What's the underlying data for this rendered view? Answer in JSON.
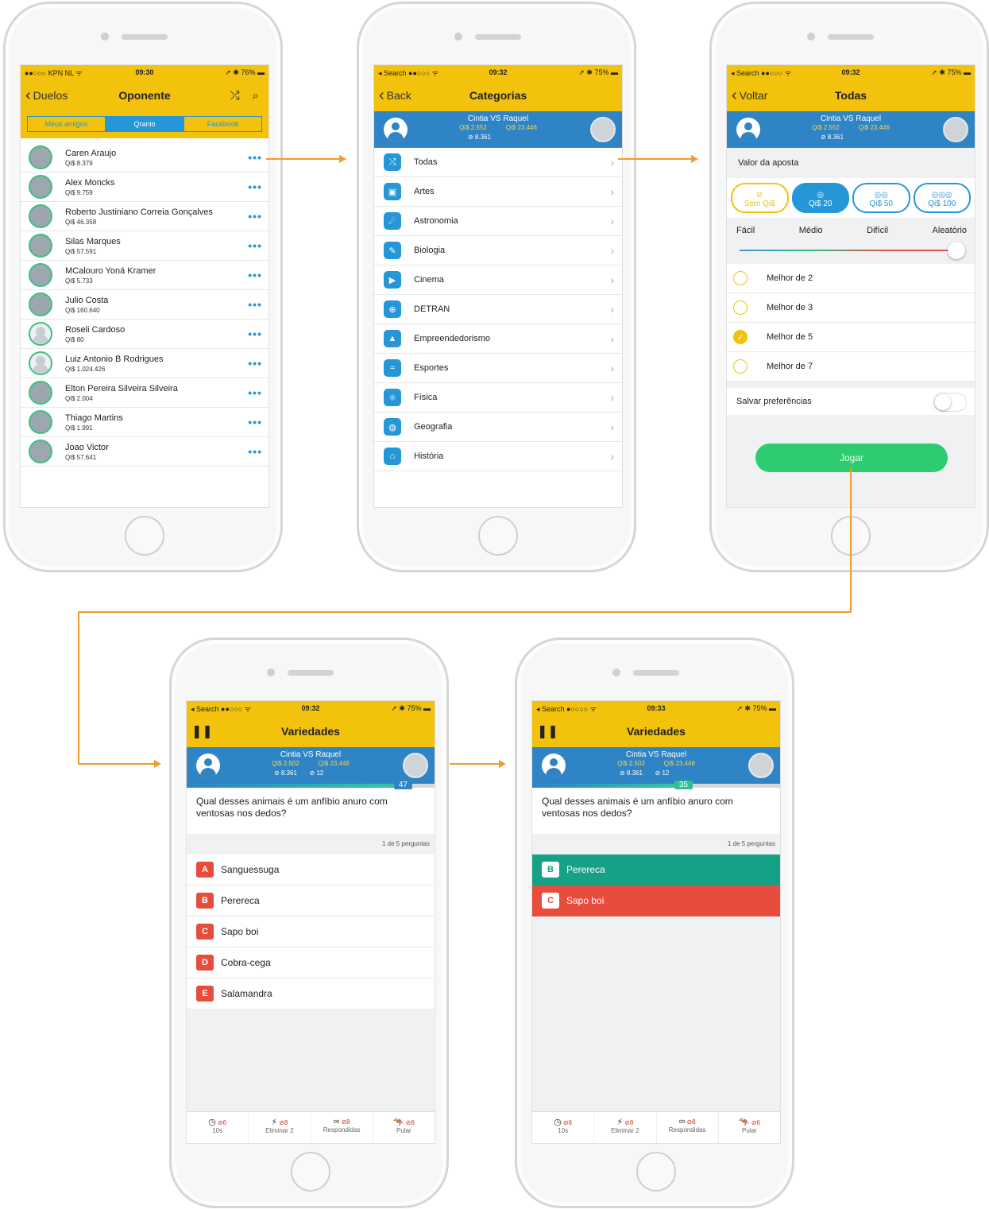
{
  "screen1": {
    "status": {
      "left": "●●○○○ KPN NL ᯤ",
      "time": "09:30",
      "right": "➚ ✱ 76% ▬"
    },
    "nav": {
      "back": "Duelos",
      "title": "Oponente"
    },
    "tabs": [
      "Meus amigos",
      "Qranio",
      "Facebook"
    ],
    "friends": [
      {
        "name": "Caren Araujo",
        "pts": "Qi$ 8.379"
      },
      {
        "name": "Alex Moncks",
        "pts": "Qi$ 9.759"
      },
      {
        "name": "Roberto Justiniano Correia Gonçalves",
        "pts": "Qi$ 46.358"
      },
      {
        "name": "Silas Marques",
        "pts": "Qi$ 57.591"
      },
      {
        "name": "MCalouro Yoná Kramer",
        "pts": "Qi$ 5.733"
      },
      {
        "name": "Julio Costa",
        "pts": "Qi$ 160.640"
      },
      {
        "name": "Roseli Cardoso",
        "pts": "Qi$ 80"
      },
      {
        "name": "Luiz Antonio B Rodrigues",
        "pts": "Qi$ 1.024.426"
      },
      {
        "name": "Elton Pereira Silveira Silveira",
        "pts": "Qi$ 2.004"
      },
      {
        "name": "Thiago Martins",
        "pts": "Qi$ 1.991"
      },
      {
        "name": "Joao Victor",
        "pts": "Qi$ 57.641"
      }
    ]
  },
  "screen2": {
    "status": {
      "left": "◂ Search ●●○○○ ᯤ",
      "time": "09:32",
      "right": "➚ ✱ 75% ▬"
    },
    "nav": {
      "back": "Back",
      "title": "Categorias"
    },
    "vs": {
      "names": "Cintia VS Raquel",
      "s1": "Qi$ 2.552",
      "s2": "Qi$ 23.446",
      "extra": "⊘ 8.361"
    },
    "categories": [
      "Todas",
      "Artes",
      "Astronomia",
      "Biologia",
      "Cinema",
      "DETRAN",
      "Empreendedorismo",
      "Esportes",
      "Física",
      "Geografia",
      "História"
    ]
  },
  "screen3": {
    "status": {
      "left": "◂ Search ●●○○○ ᯤ",
      "time": "09:32",
      "right": "➚ ✱ 75% ▬"
    },
    "nav": {
      "back": "Voltar",
      "title": "Todas"
    },
    "vs": {
      "names": "Cintia VS Raquel",
      "s1": "Qi$ 2.552",
      "s2": "Qi$ 23.446",
      "extra": "⊘ 8.361"
    },
    "bet_label": "Valor da aposta",
    "bets": [
      "Sem Qi$",
      "Qi$ 20",
      "Qi$ 50",
      "Qi$ 100"
    ],
    "difficulty": [
      "Fácil",
      "Médio",
      "Difícil",
      "Aleatório"
    ],
    "options": [
      "Melhor de 2",
      "Melhor de 3",
      "Melhor de 5",
      "Melhor de 7"
    ],
    "save_prefs": "Salvar preferências",
    "play": "Jogar"
  },
  "screen4": {
    "status": {
      "left": "◂ Search ●●○○○ ᯤ",
      "time": "09:32",
      "right": "➚ ✱ 75% ▬"
    },
    "title": "Variedades",
    "vs": {
      "names": "Cintia VS Raquel",
      "s1": "Qi$ 2.502",
      "s2": "Qi$ 23.446",
      "extra1": "⊘ 8.361",
      "extra2": "⊘ 12"
    },
    "timer": "47",
    "question": "Qual desses animais é um anfíbio anuro com ventosas nos dedos?",
    "count": "1 de 5 perguntas",
    "answers": [
      {
        "l": "A",
        "t": "Sanguessuga"
      },
      {
        "l": "B",
        "t": "Perereca"
      },
      {
        "l": "C",
        "t": "Sapo boi"
      },
      {
        "l": "D",
        "t": "Cobra-cega"
      },
      {
        "l": "E",
        "t": "Salamandra"
      }
    ],
    "powers": [
      {
        "icon": "◷",
        "n": "⊘6",
        "label": "10s"
      },
      {
        "icon": "⚡",
        "n": "⊘8",
        "label": "Eliminar 2"
      },
      {
        "icon": "∞",
        "n": "⊘8",
        "label": "Respondidas"
      },
      {
        "icon": "🦘",
        "n": "⊘6",
        "label": "Pular"
      }
    ]
  },
  "screen5": {
    "status": {
      "left": "◂ Search ●○○○○ ᯤ",
      "time": "09:33",
      "right": "➚ ✱ 75% ▬"
    },
    "title": "Variedades",
    "vs": {
      "names": "Cintia VS Raquel",
      "s1": "Qi$ 2.502",
      "s2": "Qi$ 23.446",
      "extra1": "⊘ 8.361",
      "extra2": "⊘ 12"
    },
    "timer": "35",
    "question": "Qual desses animais é um anfíbio anuro com ventosas nos dedos?",
    "count": "1 de 5 perguntas",
    "answers": [
      {
        "l": "B",
        "t": "Perereca"
      },
      {
        "l": "C",
        "t": "Sapo boi"
      }
    ],
    "powers": [
      {
        "icon": "◷",
        "n": "⊘6",
        "label": "10s"
      },
      {
        "icon": "⚡",
        "n": "⊘8",
        "label": "Eliminar 2"
      },
      {
        "icon": "∞",
        "n": "⊘8",
        "label": "Respondidas"
      },
      {
        "icon": "🦘",
        "n": "⊘6",
        "label": "Pular"
      }
    ]
  },
  "colors": {
    "header": "#f2c20d",
    "blue": "#2e84c4",
    "accent": "#2596d7",
    "green": "#2ecc71",
    "red": "#e74c3c",
    "teal": "#16a085",
    "flow": "#f39a2c"
  }
}
